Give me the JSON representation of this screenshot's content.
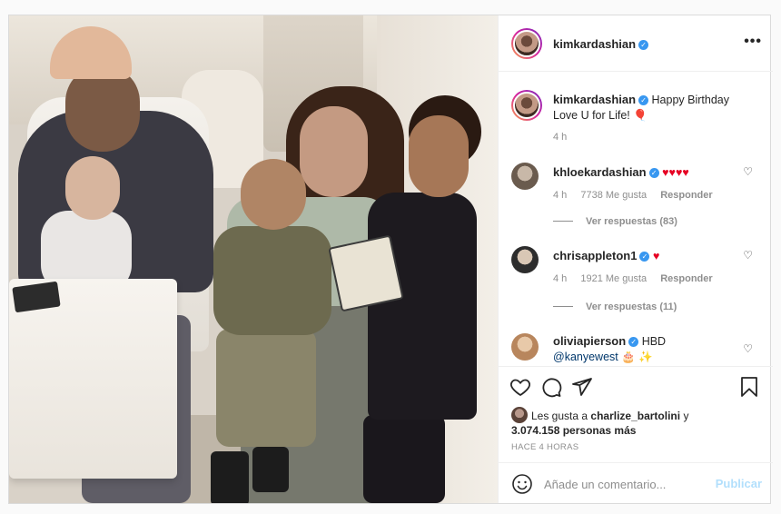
{
  "post": {
    "username": "kimkardashian",
    "verified": true,
    "more_label": "•••"
  },
  "caption": {
    "username": "kimkardashian",
    "text": "Happy Birthday Love U for Life!",
    "emoji": "🎈",
    "time": "4 h"
  },
  "comments": [
    {
      "username": "khloekardashian",
      "text": "♥♥♥♥",
      "time": "4 h",
      "likes": "7738 Me gusta",
      "reply_label": "Responder",
      "view_replies": "Ver respuestas (83)"
    },
    {
      "username": "chrisappleton1",
      "text": "♥",
      "time": "4 h",
      "likes": "1921 Me gusta",
      "reply_label": "Responder",
      "view_replies": "Ver respuestas (11)"
    },
    {
      "username": "oliviapierson",
      "text": "HBD",
      "mention": "@kanyewest",
      "emoji": "🎂 ✨"
    }
  ],
  "likes": {
    "prefix": "Les gusta a",
    "first_user": "charlize_bartolini",
    "connector": "y",
    "count_text": "3.074.158 personas más"
  },
  "timestamp": "HACE 4 HORAS",
  "add_comment": {
    "placeholder": "Añade un comentario...",
    "publish_label": "Publicar"
  },
  "icons": [
    "heart-icon",
    "comment-icon",
    "share-icon",
    "bookmark-icon",
    "smile-icon",
    "verified-icon",
    "more-icon"
  ]
}
